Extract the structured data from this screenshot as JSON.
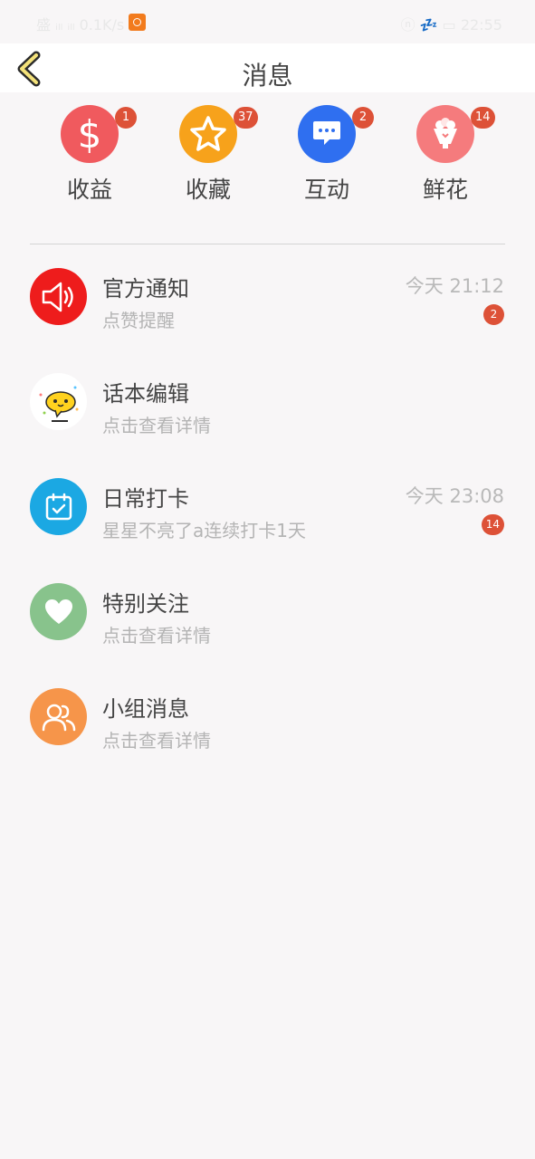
{
  "status_bar": {
    "left_text": "盛 ᵢₗₗ ᵢₗₗ 0.1K/s",
    "right_text": "ⓝ 💤 ▭ 22:55"
  },
  "header": {
    "title": "消息"
  },
  "quick_actions": [
    {
      "label": "收益",
      "badge": "1",
      "icon": "dollar-icon",
      "color": "#f05a5e"
    },
    {
      "label": "收藏",
      "badge": "37",
      "icon": "star-icon",
      "color": "#f7a21b"
    },
    {
      "label": "互动",
      "badge": "2",
      "icon": "chat-bubble-icon",
      "color": "#2f6ff0"
    },
    {
      "label": "鲜花",
      "badge": "14",
      "icon": "bouquet-icon",
      "color": "#f57b7d"
    }
  ],
  "messages": [
    {
      "title": "官方通知",
      "subtitle": "点赞提醒",
      "time": "今天 21:12",
      "badge": "2",
      "icon": "megaphone-icon",
      "color": "#ee1c1c"
    },
    {
      "title": "话本编辑",
      "subtitle": "点击查看详情",
      "icon": "chat-mascot-icon",
      "color": "#ffffff"
    },
    {
      "title": "日常打卡",
      "subtitle": "星星不亮了a连续打卡1天",
      "time": "今天 23:08",
      "badge": "14",
      "icon": "calendar-check-icon",
      "color": "#1ba8e3"
    },
    {
      "title": "特别关注",
      "subtitle": "点击查看详情",
      "icon": "heart-icon",
      "color": "#88c38c"
    },
    {
      "title": "小组消息",
      "subtitle": "点击查看详情",
      "icon": "group-icon",
      "color": "#f6954a"
    }
  ]
}
